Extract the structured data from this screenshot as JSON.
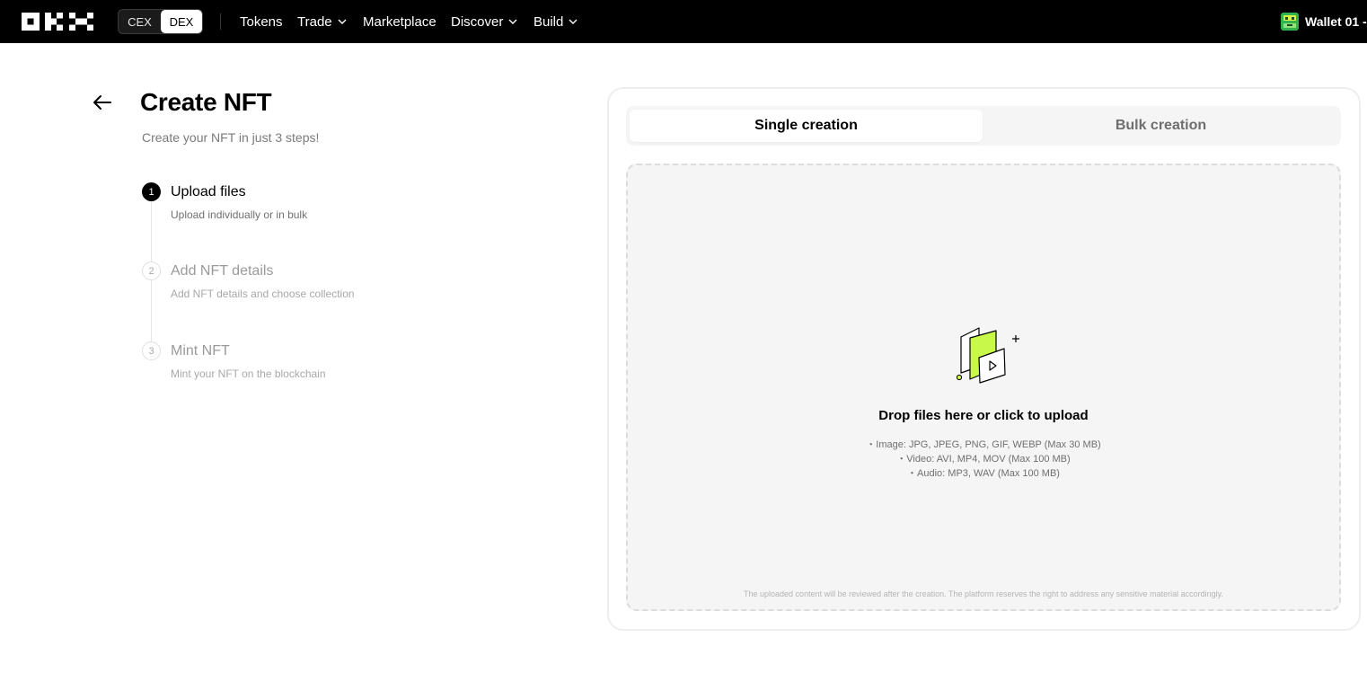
{
  "header": {
    "segment": {
      "cex": "CEX",
      "dex": "DEX",
      "selected": "DEX"
    },
    "nav": [
      {
        "label": "Tokens",
        "has_dropdown": false
      },
      {
        "label": "Trade",
        "has_dropdown": true
      },
      {
        "label": "Marketplace",
        "has_dropdown": false
      },
      {
        "label": "Discover",
        "has_dropdown": true
      },
      {
        "label": "Build",
        "has_dropdown": true
      }
    ],
    "wallet_label": "Wallet 01 -"
  },
  "page": {
    "title": "Create NFT",
    "subtitle": "Create your NFT in just 3 steps!",
    "steps": [
      {
        "num": "1",
        "title": "Upload files",
        "desc": "Upload individually or in bulk",
        "active": true
      },
      {
        "num": "2",
        "title": "Add NFT details",
        "desc": "Add NFT details and choose collection",
        "active": false
      },
      {
        "num": "3",
        "title": "Mint NFT",
        "desc": "Mint your NFT on the blockchain",
        "active": false
      }
    ]
  },
  "upload": {
    "tabs": {
      "single": "Single creation",
      "bulk": "Bulk creation",
      "selected": "single"
    },
    "drop_title": "Drop files here or click to upload",
    "formats": [
      "・Image: JPG, JPEG, PNG, GIF, WEBP (Max 30 MB)",
      "・Video: AVI, MP4, MOV (Max 100 MB)",
      "・Audio: MP3, WAV (Max 100 MB)"
    ],
    "disclaimer": "The uploaded content will be reviewed after the creation. The platform reserves the right to address any sensitive material accordingly."
  },
  "colors": {
    "accent": "#c8f94a",
    "topbar": "#000000",
    "dropzone_bg": "#f5f5f5"
  },
  "icons": [
    "okx-logo-icon",
    "chevron-down-icon",
    "wallet-avatar-icon",
    "arrow-left-icon",
    "upload-files-icon"
  ]
}
